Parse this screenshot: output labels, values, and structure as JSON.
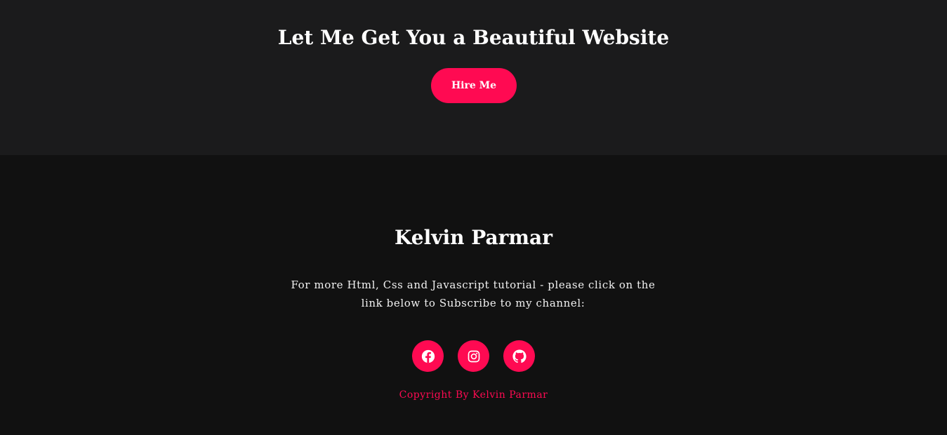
{
  "hire": {
    "title": "Let Me Get You a Beautiful Website",
    "button_label": "Hire Me"
  },
  "footer": {
    "name": "Kelvin Parmar",
    "description": "For more Html, Css and Javascript tutorial - please click on the link below to Subscribe to my channel:",
    "socials": [
      {
        "icon": "facebook-icon"
      },
      {
        "icon": "instagram-icon"
      },
      {
        "icon": "github-icon"
      }
    ],
    "copyright": "Copyright By Kelvin Parmar"
  },
  "colors": {
    "accent": "#ff0a52",
    "section_bg": "#1b1b1c",
    "footer_bg": "#111111",
    "text": "#ffffff"
  }
}
